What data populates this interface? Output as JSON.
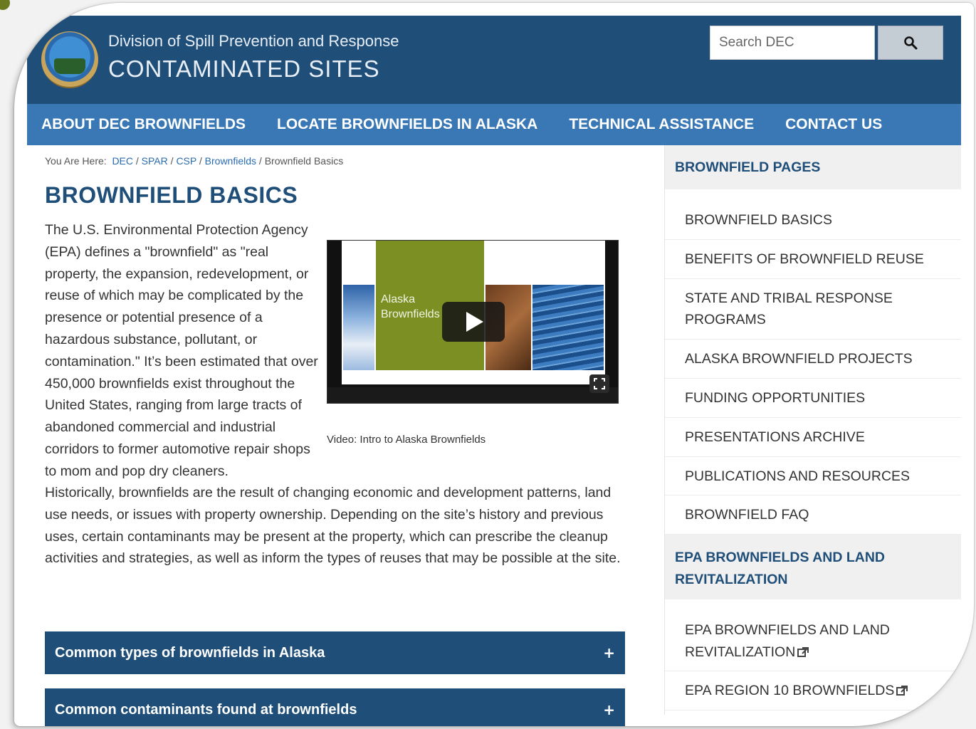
{
  "header": {
    "subtitle": "Division of Spill Prevention and Response",
    "title": "CONTAMINATED SITES",
    "search_placeholder": "Search DEC"
  },
  "nav": [
    "ABOUT DEC BROWNFIELDS",
    "LOCATE BROWNFIELDS IN ALASKA",
    "TECHNICAL ASSISTANCE",
    "CONTACT US"
  ],
  "breadcrumb": {
    "prefix": "You Are Here:",
    "links": [
      "DEC",
      "SPAR",
      "CSP",
      "Brownfields"
    ],
    "current": "Brownfield Basics",
    "separator": "/"
  },
  "main": {
    "title": "BROWNFIELD BASICS",
    "intro": "The U.S. Environmental Protection Agency (EPA) defines a \"brownfield\" as \"real property, the expansion, redevelopment, or reuse of which may be complicated by the presence or potential presence of a hazardous substance, pollutant, or contamination.\" It’s been estimated that over 450,000 brownfields exist throughout the United States, ranging from large tracts of abandoned commercial and industrial corridors to former automotive repair shops to mom and pop dry cleaners.",
    "para2": "Historically, brownfields are the result of changing economic and development patterns, land use needs, or issues with property ownership. Depending on the site’s history and previous uses, certain contaminants may be present at the property, which can prescribe the cleanup activities and strategies, as well as inform the types of reuses that may be possible at the site.",
    "video": {
      "slide_title_1": "Alaska",
      "slide_title_2": "Brownfields",
      "caption": "Video: Intro to Alaska Brownfields"
    },
    "accordions": [
      "Common types of brownfields in Alaska",
      "Common contaminants found at brownfields"
    ],
    "accordion_icon": "+"
  },
  "sidebar": {
    "section1_title": "BROWNFIELD PAGES",
    "section1_items": [
      "BROWNFIELD BASICS",
      "BENEFITS OF BROWNFIELD REUSE",
      "STATE AND TRIBAL RESPONSE PROGRAMS",
      "ALASKA BROWNFIELD PROJECTS",
      "FUNDING OPPORTUNITIES",
      "PRESENTATIONS ARCHIVE",
      "PUBLICATIONS AND RESOURCES",
      "BROWNFIELD FAQ"
    ],
    "section2_title": "EPA BROWNFIELDS AND LAND REVITALIZATION",
    "section2_items": [
      "EPA BROWNFIELDS AND LAND REVITALIZATION",
      "EPA REGION 10 BROWNFIELDS"
    ]
  },
  "colors": {
    "header_bg": "#1f4e79",
    "nav_bg": "#3a78b5",
    "link": "#2a6cb0",
    "title": "#1f4e79"
  }
}
